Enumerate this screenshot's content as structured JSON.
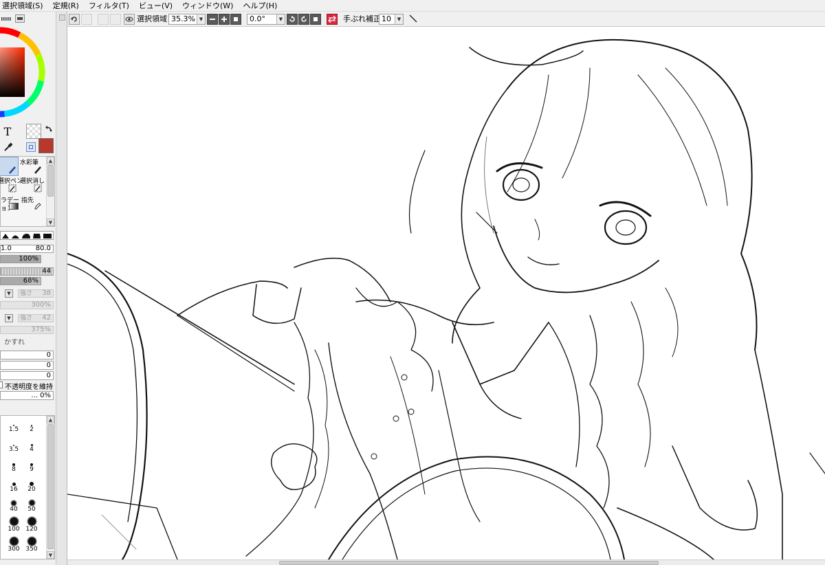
{
  "menu": [
    "選択領域(S)",
    "定規(R)",
    "フィルタ(T)",
    "ビュー(V)",
    "ウィンドウ(W)",
    "ヘルプ(H)"
  ],
  "colors": {
    "main_color": "#b8392b",
    "accent_red": "#d9273b",
    "brush_selected_bg": "#c9d9ee",
    "canvas_bg": "#ffffff"
  },
  "toolbar": {
    "selection_label": "選択領域",
    "zoom_value": "35.3%",
    "rotation_value": "0.0°",
    "stabilizer_label": "手ぶれ補正",
    "stabilizer_value": "10"
  },
  "tools": {
    "text_tool_glyph": "T",
    "watercolor_label": "水彩筆",
    "selpen_label": "選択ペン",
    "seleraser_label": "選択消し",
    "gradation_label_1": "ラデー",
    "gradation_label_2": "ョン",
    "blur_label": "指先"
  },
  "brush_settings": {
    "size_min": "1.0",
    "size_value": "80.0",
    "density": "100%",
    "param1": "44",
    "param2": "68%",
    "texture_label": "強さ",
    "texture_value": "38",
    "texture_scale": "300%",
    "blend_label": "強さ",
    "blend_value": "42",
    "blend_scale": "375%",
    "blur_label": "かすれ",
    "num1": "0",
    "num2": "0",
    "num3": "0",
    "keep_opacity_label": "不透明度を維持",
    "bottom_value": "... 0%"
  },
  "brush_sizes": [
    "1.5",
    "2",
    "3.5",
    "4",
    "8",
    "9",
    "16",
    "20",
    "40",
    "50",
    "100",
    "120",
    "300",
    "350"
  ]
}
